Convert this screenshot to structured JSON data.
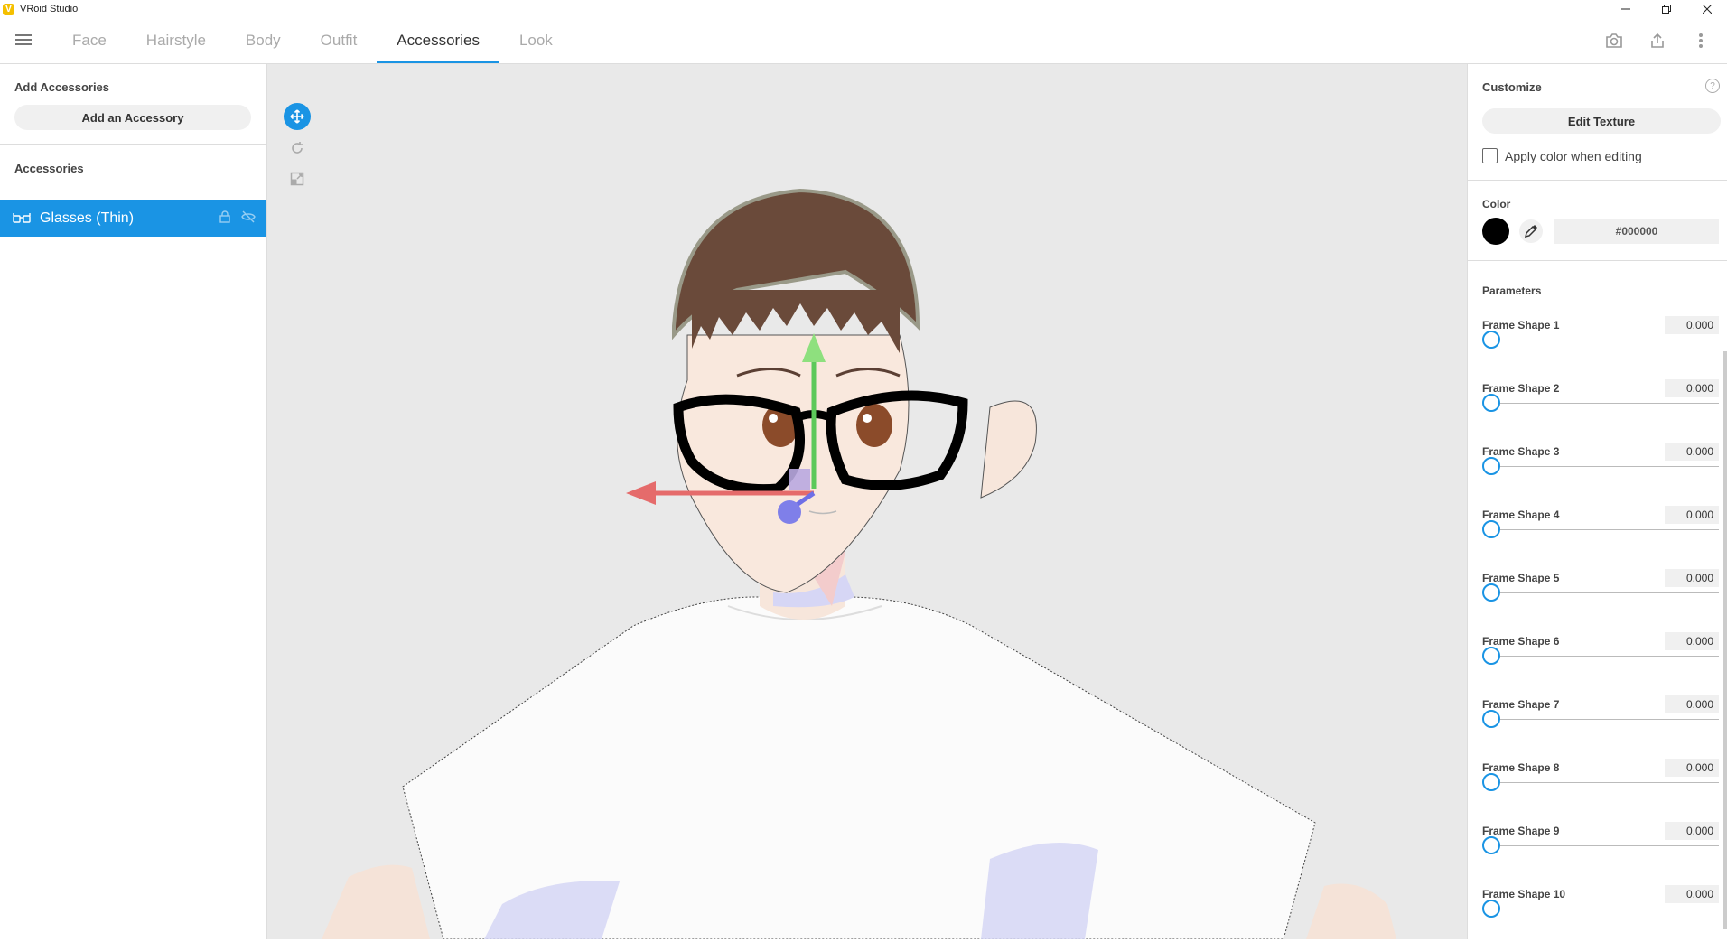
{
  "window": {
    "title": "VRoid Studio",
    "logo_glyph": "V",
    "controls": [
      "minimize-icon",
      "restore-icon",
      "close-icon"
    ]
  },
  "menubar": {
    "menu_icon": "hamburger-icon",
    "tabs": [
      {
        "label": "Face",
        "active": false
      },
      {
        "label": "Hairstyle",
        "active": false
      },
      {
        "label": "Body",
        "active": false
      },
      {
        "label": "Outfit",
        "active": false
      },
      {
        "label": "Accessories",
        "active": true
      },
      {
        "label": "Look",
        "active": false
      }
    ],
    "actions": [
      "camera-icon",
      "export-icon",
      "more-vert-icon"
    ]
  },
  "left_panel": {
    "add_section_title": "Add Accessories",
    "add_button_label": "Add an Accessory",
    "accessories_title": "Accessories",
    "items": [
      {
        "label": "Glasses (Thin)",
        "icon": "glasses-icon",
        "selected": true,
        "actions": [
          "lock-icon",
          "visibility-off-icon"
        ]
      }
    ]
  },
  "viewport": {
    "tools": [
      "move-tool-icon",
      "rotate-tool-icon",
      "scale-tool-icon"
    ],
    "active_tool": "move-tool-icon",
    "accent": "#1a94e4"
  },
  "right_panel": {
    "customize_title": "Customize",
    "help_glyph": "?",
    "edit_texture_label": "Edit Texture",
    "apply_color_label": "Apply color when editing",
    "apply_color_checked": false,
    "color_title": "Color",
    "color_hex": "#000000",
    "parameters_title": "Parameters",
    "parameters": [
      {
        "label": "Frame Shape 1",
        "value": "0.000"
      },
      {
        "label": "Frame Shape 2",
        "value": "0.000"
      },
      {
        "label": "Frame Shape 3",
        "value": "0.000"
      },
      {
        "label": "Frame Shape 4",
        "value": "0.000"
      },
      {
        "label": "Frame Shape 5",
        "value": "0.000"
      },
      {
        "label": "Frame Shape 6",
        "value": "0.000"
      },
      {
        "label": "Frame Shape 7",
        "value": "0.000"
      },
      {
        "label": "Frame Shape 8",
        "value": "0.000"
      },
      {
        "label": "Frame Shape 9",
        "value": "0.000"
      },
      {
        "label": "Frame Shape 10",
        "value": "0.000"
      }
    ]
  }
}
